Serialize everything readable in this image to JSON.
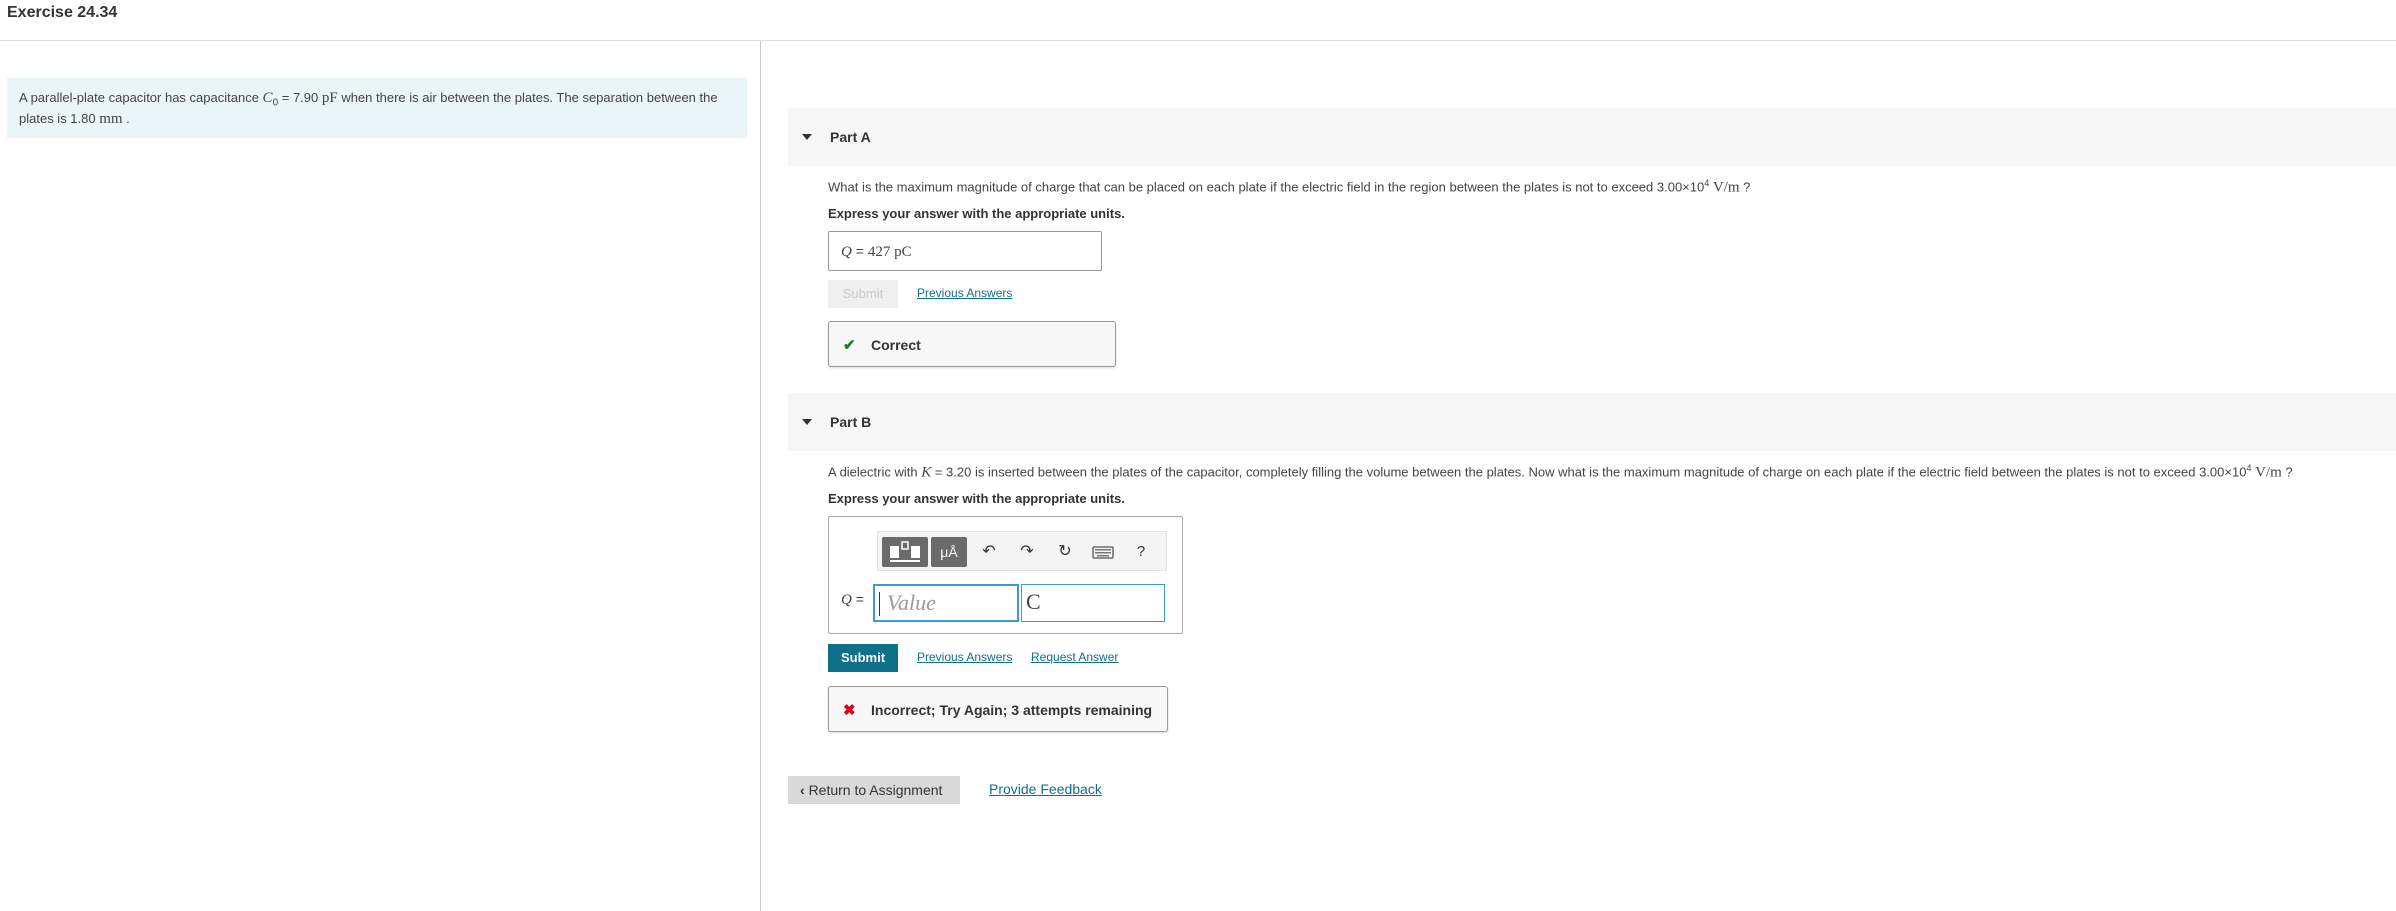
{
  "page": {
    "title": "Exercise 24.34"
  },
  "intro": {
    "text_before_c": "A parallel-plate capacitor has capacitance ",
    "c_symbol": "C",
    "c_sub": "0",
    "text_mid": " = 7.90 ",
    "c_unit": "pF",
    "text_after": " when there is air between the plates. The separation between the plates is 1.80 ",
    "sep_unit": "mm",
    "end": " ."
  },
  "partA": {
    "label": "Part A",
    "question_before": "What is the maximum magnitude of charge that can be placed on each plate if the electric field in the region between the plates is not to exceed 3.00×10",
    "exp": "4",
    "unit": "V/m",
    "question_end": " ?",
    "express": "Express your answer with the appropriate units.",
    "answer_var": "Q",
    "answer_eq": " = ",
    "answer_value": "427 pC",
    "submit_label": "Submit",
    "previous_answers": "Previous Answers",
    "feedback": "Correct"
  },
  "partB": {
    "label": "Part B",
    "question_before": "A dielectric with ",
    "k_symbol": "K",
    "question_mid": " = 3.20 is inserted between the plates of the capacitor, completely filling the volume between the plates. Now what is the maximum magnitude of charge on each plate if the electric field between the plates is not to exceed 3.00×10",
    "exp": "4",
    "unit": "V/m",
    "question_end": " ?",
    "express": "Express your answer with the appropriate units.",
    "answer_var": "Q",
    "answer_eq": " = ",
    "value_placeholder": "Value",
    "unit_value": "C",
    "toolbar": {
      "templates_label": "",
      "units_label": "μÅ",
      "help_label": "?"
    },
    "submit_label": "Submit",
    "previous_answers": "Previous Answers",
    "request_answer": "Request Answer",
    "feedback": "Incorrect; Try Again; 3 attempts remaining"
  },
  "footer": {
    "return_label": "Return to Assignment",
    "feedback_link": "Provide Feedback"
  },
  "colors": {
    "accent": "#0f708a",
    "correct": "#1a7f2e",
    "incorrect": "#d0021b",
    "intro_bg": "#e9f5f6"
  },
  "icons": [
    "caret-down-icon",
    "checkmark-icon",
    "x-mark-icon",
    "templates-icon",
    "undo-icon",
    "redo-icon",
    "reset-icon",
    "keyboard-icon",
    "help-icon",
    "chevron-left-icon"
  ]
}
